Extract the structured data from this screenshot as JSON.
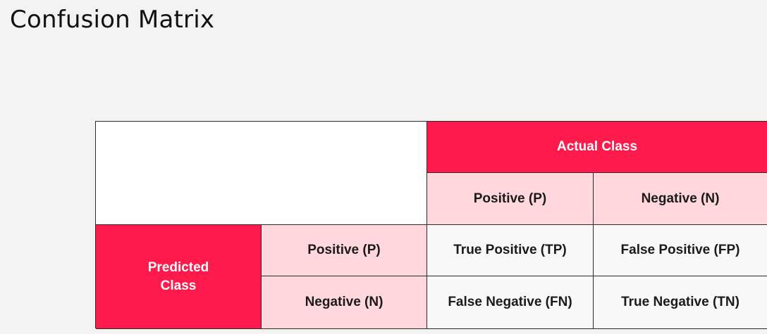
{
  "title": "Confusion Matrix",
  "matrix": {
    "actual_header": "Actual Class",
    "predicted_header": "Predicted\nClass",
    "actual_labels": [
      "Positive (P)",
      "Negative (N)"
    ],
    "predicted_labels": [
      "Positive (P)",
      "Negative (N)"
    ],
    "cells": {
      "tp": "True Positive (TP)",
      "fp": "False Positive (FP)",
      "fn": "False Negative (FN)",
      "tn": "True Negative (TN)"
    }
  },
  "colors": {
    "accent": "#ff1a4b",
    "pink": "#ffd7dc",
    "background": "#f3f3f3"
  }
}
